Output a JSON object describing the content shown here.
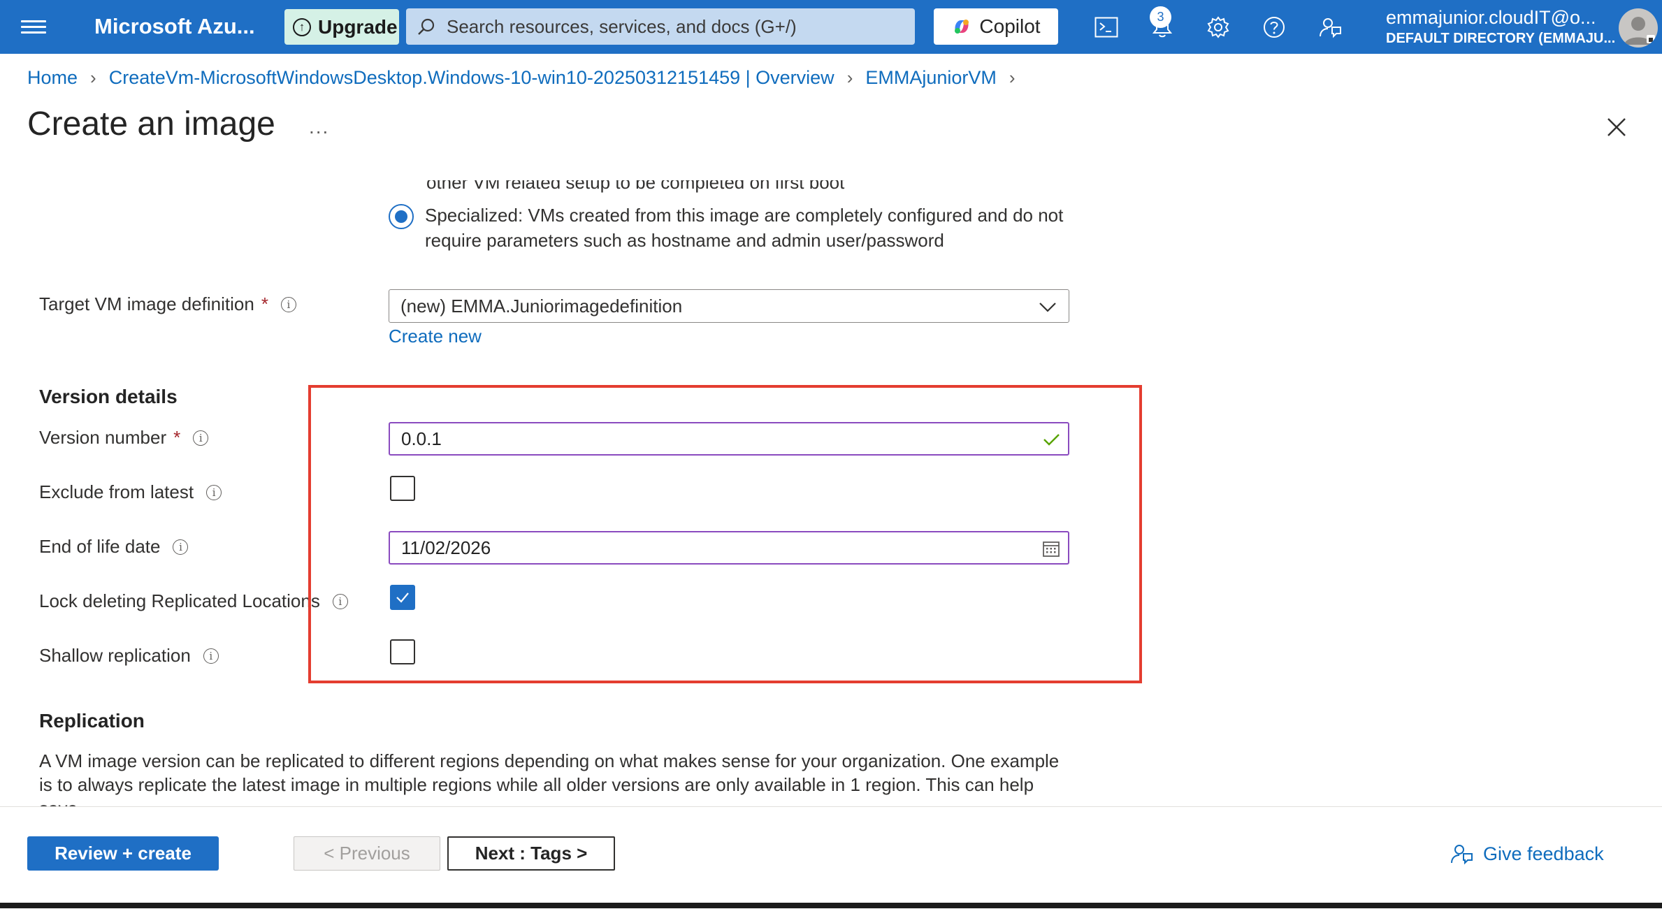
{
  "topbar": {
    "brand": "Microsoft Azu...",
    "upgrade_label": "Upgrade",
    "search_placeholder": "Search resources, services, and docs (G+/)",
    "copilot_label": "Copilot",
    "notification_count": "3",
    "account_name": "emmajunior.cloudIT@o...",
    "account_directory": "DEFAULT DIRECTORY (EMMAJU...",
    "icons": [
      "menu-icon",
      "cloud-shell-icon",
      "bell-icon",
      "gear-icon",
      "help-icon",
      "feedback-icon"
    ]
  },
  "breadcrumb": {
    "items": [
      "Home",
      "CreateVm-MicrosoftWindowsDesktop.Windows-10-win10-20250312151459 | Overview",
      "EMMAjuniorVM"
    ]
  },
  "page": {
    "title": "Create an image",
    "more_label": "..."
  },
  "form": {
    "cut_text": "other VM related setup to be completed on first boot",
    "specialized_text": "Specialized: VMs created from this image are completely configured and do not require parameters such as hostname and admin user/password",
    "target_label": "Target VM image definition",
    "required_mark": "*",
    "target_value": "(new) EMMA.Juniorimagedefinition",
    "create_new": "Create new",
    "version_section": "Version details",
    "version_label": "Version number",
    "version_value": "0.0.1",
    "exclude_label": "Exclude from latest",
    "exclude_checked": false,
    "eol_label": "End of life date",
    "eol_value": "11/02/2026",
    "lock_label": "Lock deleting Replicated Locations",
    "lock_checked": true,
    "shallow_label": "Shallow replication",
    "shallow_checked": false,
    "replication_section": "Replication",
    "replication_text": "A VM image version can be replicated to different regions depending on what makes sense for your organization. One example is to always replicate the latest image in multiple regions while all older versions are only available in 1 region. This can help save"
  },
  "footer": {
    "review_label": "Review + create",
    "previous_label": "< Previous",
    "next_label": "Next : Tags >",
    "feedback_label": "Give feedback"
  },
  "colors": {
    "accent": "#1f6fc5",
    "highlight": "#e43d30",
    "link": "#0f6cbd",
    "field_border": "#8a4bbf"
  }
}
